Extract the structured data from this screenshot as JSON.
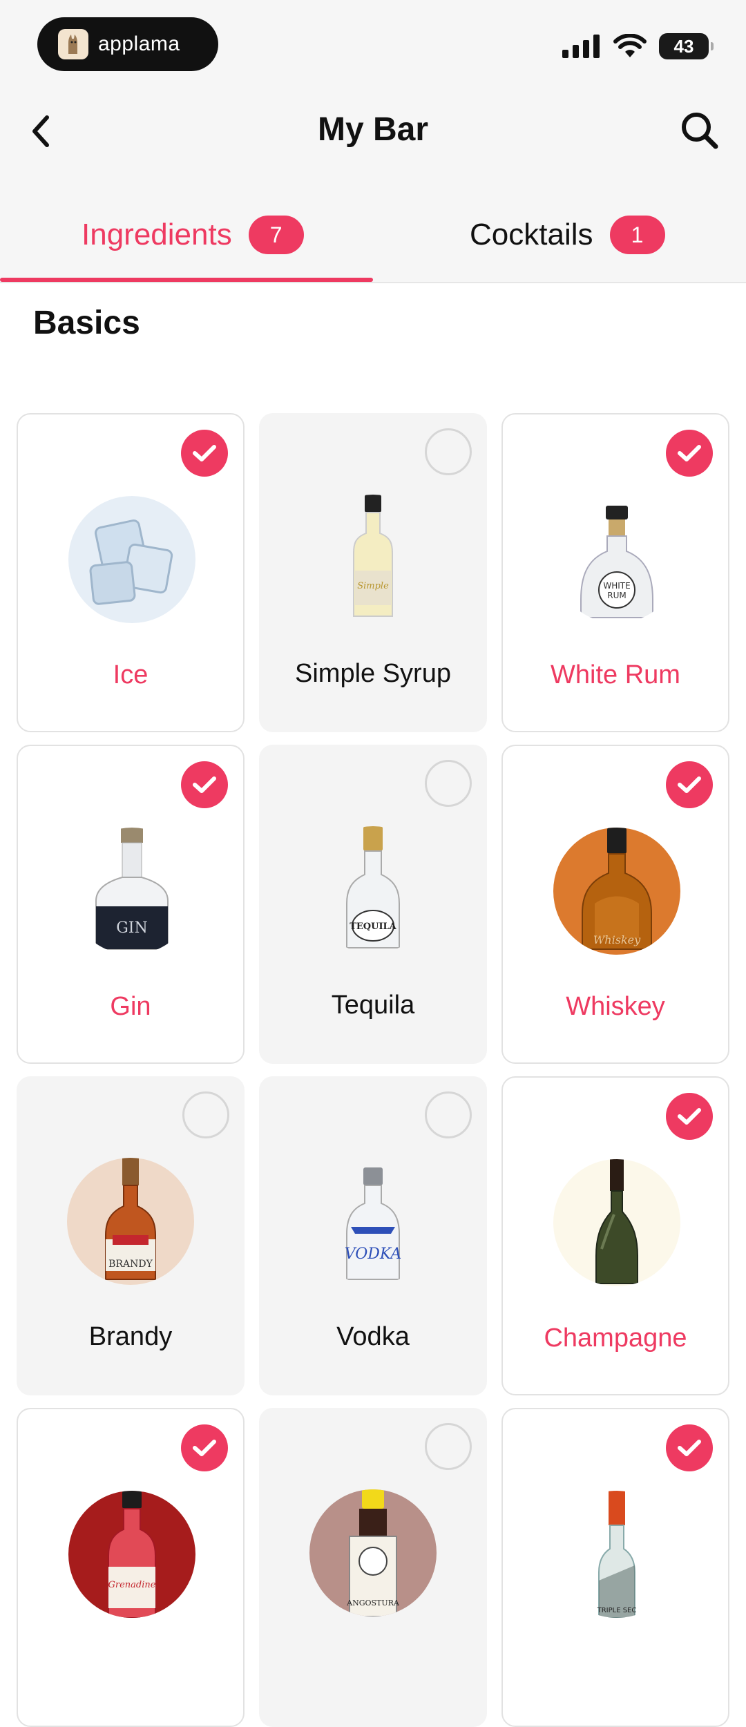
{
  "status": {
    "brand": "applama",
    "battery": "43"
  },
  "nav": {
    "title": "My Bar"
  },
  "tabs": [
    {
      "label": "Ingredients",
      "count": "7",
      "active": true
    },
    {
      "label": "Cocktails",
      "count": "1",
      "active": false
    }
  ],
  "section": {
    "title": "Basics"
  },
  "items": [
    {
      "label": "Ice",
      "selected": true,
      "icon": "ice-cubes"
    },
    {
      "label": "Simple Syrup",
      "selected": false,
      "icon": "syrup-bottle"
    },
    {
      "label": "White Rum",
      "selected": true,
      "icon": "rum-bottle"
    },
    {
      "label": "Gin",
      "selected": true,
      "icon": "gin-bottle"
    },
    {
      "label": "Tequila",
      "selected": false,
      "icon": "tequila-bottle"
    },
    {
      "label": "Whiskey",
      "selected": true,
      "icon": "whiskey-bottle"
    },
    {
      "label": "Brandy",
      "selected": false,
      "icon": "brandy-bottle"
    },
    {
      "label": "Vodka",
      "selected": false,
      "icon": "vodka-bottle"
    },
    {
      "label": "Champagne",
      "selected": true,
      "icon": "champagne-bottle"
    },
    {
      "label": "Grenadine",
      "selected": true,
      "icon": "grenadine-bottle"
    },
    {
      "label": "Angostura",
      "selected": false,
      "icon": "bitters-bottle"
    },
    {
      "label": "Triple Sec",
      "selected": true,
      "icon": "triple-sec-bottle"
    }
  ],
  "colors": {
    "accent": "#ee3a61",
    "background": "#f6f6f6"
  }
}
